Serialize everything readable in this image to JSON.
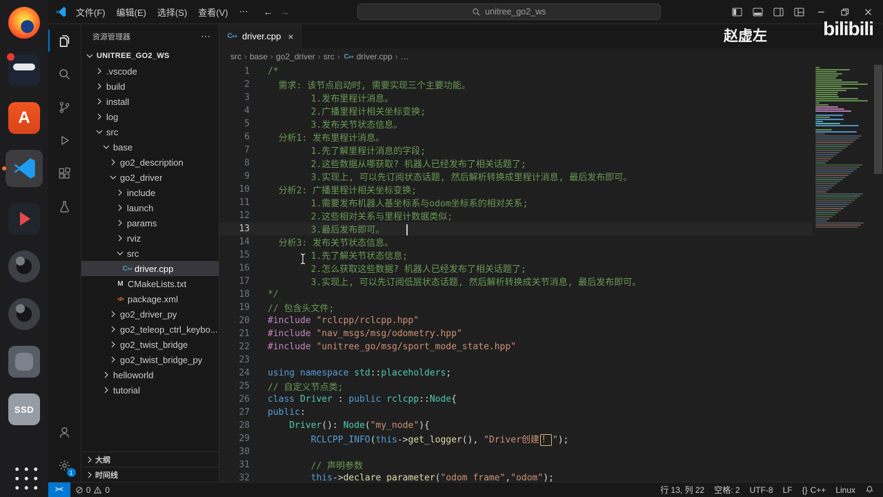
{
  "colors": {
    "accent": "#0078d4",
    "remote": "#0078d4",
    "selection": "#37373d",
    "cmt": "#6A9955",
    "kw": "#569CD6",
    "str": "#CE9178",
    "type": "#4EC9B0",
    "fn": "#DCDCAA",
    "pp": "#C586C0",
    "plain": "#D4D4D4",
    "lineno": "#6e7681",
    "cpp_icon": "#519aba",
    "xml_icon": "#e37933"
  },
  "dock": {
    "items": [
      {
        "name": "firefox"
      },
      {
        "name": "screen-recorder"
      },
      {
        "name": "ubuntu-software"
      },
      {
        "name": "vscode",
        "running": true,
        "active": true
      },
      {
        "name": "media-app"
      },
      {
        "name": "camera-app-1"
      },
      {
        "name": "camera-app-2"
      },
      {
        "name": "gray-app"
      },
      {
        "name": "ssd-drive",
        "label": "SSD"
      },
      {
        "name": "app-grid"
      }
    ]
  },
  "titlebar": {
    "menus": [
      "文件(F)",
      "编辑(E)",
      "选择(S)",
      "查看(V)"
    ],
    "overflow": "⋯",
    "search_value": "unitree_go2_ws"
  },
  "activitybar": {
    "top": [
      {
        "name": "explorer",
        "active": true
      },
      {
        "name": "search"
      },
      {
        "name": "source-control"
      },
      {
        "name": "run-debug"
      },
      {
        "name": "extensions"
      },
      {
        "name": "testing"
      }
    ],
    "bottom": [
      {
        "name": "accounts"
      },
      {
        "name": "settings",
        "badge": "1"
      }
    ]
  },
  "sidebar": {
    "title": "资源管理器",
    "actions": "⋯",
    "workspace": "UNITREE_GO2_WS",
    "tree": [
      {
        "l": ".vscode",
        "d": 1,
        "t": "dir",
        "e": false
      },
      {
        "l": "build",
        "d": 1,
        "t": "dir",
        "e": false
      },
      {
        "l": "install",
        "d": 1,
        "t": "dir",
        "e": false
      },
      {
        "l": "log",
        "d": 1,
        "t": "dir",
        "e": false
      },
      {
        "l": "src",
        "d": 1,
        "t": "dir",
        "e": true
      },
      {
        "l": "base",
        "d": 2,
        "t": "dir",
        "e": true
      },
      {
        "l": "go2_description",
        "d": 3,
        "t": "dir",
        "e": false
      },
      {
        "l": "go2_driver",
        "d": 3,
        "t": "dir",
        "e": true
      },
      {
        "l": "include",
        "d": 4,
        "t": "dir",
        "e": false
      },
      {
        "l": "launch",
        "d": 4,
        "t": "dir",
        "e": false
      },
      {
        "l": "params",
        "d": 4,
        "t": "dir",
        "e": false
      },
      {
        "l": "rviz",
        "d": 4,
        "t": "dir",
        "e": false
      },
      {
        "l": "src",
        "d": 4,
        "t": "dir",
        "e": true
      },
      {
        "l": "driver.cpp",
        "d": 5,
        "t": "file",
        "icon": "cpp",
        "sel": true
      },
      {
        "l": "CMakeLists.txt",
        "d": 4,
        "t": "file",
        "icon": "cmake"
      },
      {
        "l": "package.xml",
        "d": 4,
        "t": "file",
        "icon": "xml"
      },
      {
        "l": "go2_driver_py",
        "d": 3,
        "t": "dir",
        "e": false
      },
      {
        "l": "go2_teleop_ctrl_keybo...",
        "d": 3,
        "t": "dir",
        "e": false
      },
      {
        "l": "go2_twist_bridge",
        "d": 3,
        "t": "dir",
        "e": false
      },
      {
        "l": "go2_twist_bridge_py",
        "d": 3,
        "t": "dir",
        "e": false
      },
      {
        "l": "helloworld",
        "d": 2,
        "t": "dir",
        "e": false
      },
      {
        "l": "tutorial",
        "d": 2,
        "t": "dir",
        "e": false
      }
    ],
    "panels": [
      {
        "name": "outline",
        "label": "大纲"
      },
      {
        "name": "timeline",
        "label": "时间线"
      }
    ]
  },
  "editor": {
    "tab": {
      "label": "driver.cpp",
      "close_glyph": "×"
    },
    "breadcrumbs": [
      "src",
      "base",
      "go2_driver",
      "src",
      "driver.cpp",
      "…"
    ],
    "cursor": {
      "line": 13,
      "col": 22
    },
    "lines": [
      [
        [
          "/*",
          "cmt"
        ]
      ],
      [
        [
          "  需求: 该节点启动时, 需要实现三个主要功能。",
          "cmt"
        ]
      ],
      [
        [
          "        1.发布里程计消息。",
          "cmt"
        ]
      ],
      [
        [
          "        2.广播里程计相关坐标变换;",
          "cmt"
        ]
      ],
      [
        [
          "        3.发布关节状态信息。",
          "cmt"
        ]
      ],
      [
        [
          "  分析1: 发布里程计消息。",
          "cmt"
        ]
      ],
      [
        [
          "        1.先了解里程计消息的字段;",
          "cmt"
        ]
      ],
      [
        [
          "        2.这些数据从哪获取? 机器人已经发布了相关话题了;",
          "cmt"
        ]
      ],
      [
        [
          "        3.实现上, 可以先订阅状态话题, 然后解析转换成里程计消息, 最后发布即可。",
          "cmt"
        ]
      ],
      [
        [
          "  分析2: 广播里程计相关坐标变换;",
          "cmt"
        ]
      ],
      [
        [
          "        1.需要发布机器人基坐标系与odom坐标系的相对关系;",
          "cmt"
        ]
      ],
      [
        [
          "        2.这些相对关系与里程计数据类似;",
          "cmt"
        ]
      ],
      [
        [
          "        3.最后发布即可。",
          "cmt"
        ],
        [
          "    ",
          ""
        ],
        [
          "",
          "cursor"
        ]
      ],
      [
        [
          "  分析3: 发布关节状态信息。",
          "cmt"
        ]
      ],
      [
        [
          "        1.先了解关节状态信息;",
          "cmt"
        ]
      ],
      [
        [
          "        2.怎么获取这些数据? 机器人已经发布了相关话题了;",
          "cmt"
        ]
      ],
      [
        [
          "        3.实现上, 可以先订阅低层状态话题, 然后解析转换成关节消息, 最后发布即可。",
          "cmt"
        ]
      ],
      [
        [
          "*/",
          "cmt"
        ]
      ],
      [
        [
          "// 包含头文件;",
          "cmt"
        ]
      ],
      [
        [
          "#include",
          "pp"
        ],
        [
          " ",
          ""
        ],
        [
          "\"rclcpp/rclcpp.hpp\"",
          "str"
        ]
      ],
      [
        [
          "#include",
          "pp"
        ],
        [
          " ",
          ""
        ],
        [
          "\"nav_msgs/msg/odometry.hpp\"",
          "str"
        ]
      ],
      [
        [
          "#include",
          "pp"
        ],
        [
          " ",
          ""
        ],
        [
          "\"unitree_go/msg/sport_mode_state.hpp\"",
          "str"
        ]
      ],
      [],
      [
        [
          "using",
          "kw"
        ],
        [
          " ",
          ""
        ],
        [
          "namespace",
          "kw"
        ],
        [
          " ",
          ""
        ],
        [
          "std",
          "type"
        ],
        [
          "::",
          ""
        ],
        [
          "placeholders",
          "type"
        ],
        [
          ";",
          ""
        ]
      ],
      [
        [
          "// 自定义节点类;",
          "cmt"
        ]
      ],
      [
        [
          "class",
          "kw"
        ],
        [
          " ",
          ""
        ],
        [
          "Driver",
          "type"
        ],
        [
          " : ",
          ""
        ],
        [
          "public",
          "kw"
        ],
        [
          " ",
          ""
        ],
        [
          "rclcpp",
          "type"
        ],
        [
          "::",
          ""
        ],
        [
          "Node",
          "type"
        ],
        [
          "{",
          ""
        ]
      ],
      [
        [
          "public",
          "kw"
        ],
        [
          ":",
          ""
        ]
      ],
      [
        [
          "    ",
          ""
        ],
        [
          "Driver",
          "type"
        ],
        [
          "(): ",
          ""
        ],
        [
          "Node",
          "type"
        ],
        [
          "(",
          ""
        ],
        [
          "\"my_node\"",
          "str"
        ],
        [
          "){",
          ""
        ]
      ],
      [
        [
          "        ",
          ""
        ],
        [
          "RCLCPP_INFO",
          "kw"
        ],
        [
          "(",
          ""
        ],
        [
          "this",
          "kw"
        ],
        [
          "->",
          ""
        ],
        [
          "get_logger",
          "fn"
        ],
        [
          "(), ",
          ""
        ],
        [
          "\"Driver创建",
          "str"
        ],
        [
          "！",
          "strbox"
        ],
        [
          "\"",
          "str"
        ],
        [
          ");",
          ""
        ]
      ],
      [],
      [
        [
          "        // 声明参数",
          "cmt"
        ]
      ],
      [
        [
          "        ",
          ""
        ],
        [
          "this",
          "kw"
        ],
        [
          "->",
          ""
        ],
        [
          "declare_parameter",
          "fn"
        ],
        [
          "(",
          ""
        ],
        [
          "\"odom_frame\"",
          "str"
        ],
        [
          ",",
          ""
        ],
        [
          "\"odom\"",
          "str"
        ],
        [
          ");",
          ""
        ]
      ]
    ]
  },
  "statusbar": {
    "remote_label": "><",
    "problems": {
      "errors": "0",
      "warnings": "0"
    },
    "right": [
      {
        "name": "cursor-position",
        "label": "行 13, 列 22"
      },
      {
        "name": "indentation",
        "label": "空格: 2"
      },
      {
        "name": "encoding",
        "label": "UTF-8"
      },
      {
        "name": "eol",
        "label": "LF"
      },
      {
        "name": "language-mode",
        "label": "C++",
        "icon": "braces"
      },
      {
        "name": "os",
        "label": "Linux"
      }
    ]
  },
  "watermark": {
    "author": "赵虚左",
    "logo_text": "bilibili"
  }
}
